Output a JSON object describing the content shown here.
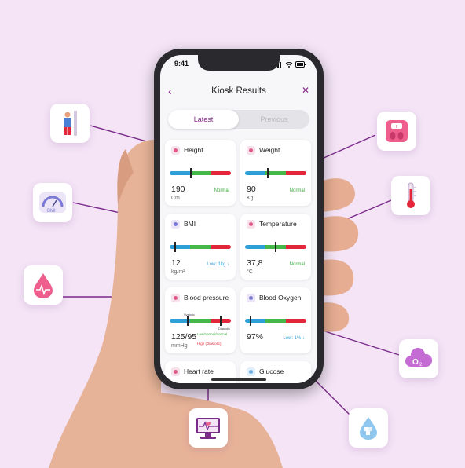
{
  "status_bar": {
    "time": "9:41"
  },
  "header": {
    "title": "Kiosk Results",
    "back_icon": "chevron-left-icon",
    "close_icon": "close-icon"
  },
  "tabs": [
    {
      "label": "Latest",
      "active": true
    },
    {
      "label": "Previous",
      "active": false
    }
  ],
  "cards": {
    "height": {
      "label": "Height",
      "value": "190",
      "unit": "Cm",
      "status": "Normal"
    },
    "weight": {
      "label": "Weight",
      "value": "90",
      "unit": "Kg",
      "status": "Normal"
    },
    "bmi": {
      "label": "BMI",
      "value": "12",
      "unit": "kg/m²",
      "status": "Low: 1kg ↓"
    },
    "temperature": {
      "label": "Temperature",
      "value": "37,8",
      "unit": "°C",
      "status": "Normal"
    },
    "blood_pressure": {
      "label": "Blood pressure",
      "value": "125/95",
      "unit": "mmHg",
      "status_1": "Low/normal/normal",
      "status_2": "High (Diastolic)",
      "marker_1": "Systolic",
      "marker_2": "Diastolic"
    },
    "blood_oxygen": {
      "label": "Blood Oxygen",
      "value": "97%",
      "unit": "",
      "status": "Low: 1% ↓"
    },
    "heart_rate": {
      "label": "Heart rate"
    },
    "glucose": {
      "label": "Glucose"
    }
  },
  "floating_icons": [
    "height-measure-icon",
    "bmi-gauge-icon",
    "blood-drop-icon",
    "weight-scale-icon",
    "thermometer-icon",
    "oxygen-cloud-icon",
    "glucose-drop-icon",
    "heart-monitor-icon"
  ],
  "colors": {
    "accent": "#8a2a8e",
    "background": "#f4e4f6",
    "low": "#2f9fd8",
    "normal": "#46b84a",
    "high": "#e3263a"
  }
}
